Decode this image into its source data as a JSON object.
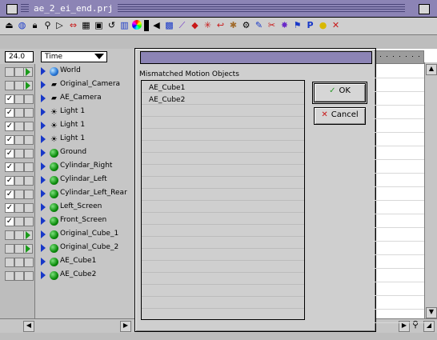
{
  "window": {
    "title": "ae_2_ei_end.prj"
  },
  "toolbar": {
    "icons": [
      "eject-icon",
      "disc-icon",
      "lock-icon",
      "magnifier-icon",
      "play-icon",
      "fit-icon",
      "film-icon",
      "save-icon",
      "undo-icon",
      "strip-icon",
      "color-wheel-icon",
      "lightning-icon",
      "speaker-icon",
      "grid-icon",
      "wand-icon",
      "bone-icon",
      "cross-icon",
      "hook-icon",
      "figure-icon",
      "dish-icon",
      "gear-icon",
      "pencil-icon",
      "tool-icon",
      "network-icon",
      "flag-icon",
      "p-icon",
      "bulb-icon",
      "marker-icon"
    ],
    "p_label": "P"
  },
  "outline": {
    "fps": "24.0",
    "time_select": "Time",
    "items": [
      {
        "label": "World",
        "icon": "world",
        "check": false,
        "track": "play"
      },
      {
        "label": "Original_Camera",
        "icon": "camera",
        "check": false,
        "track": "play"
      },
      {
        "label": "AE_Camera",
        "icon": "camera",
        "check": true,
        "track": "none"
      },
      {
        "label": "Light 1",
        "icon": "light",
        "check": true,
        "track": "none"
      },
      {
        "label": "Light 1",
        "icon": "light",
        "check": true,
        "track": "none"
      },
      {
        "label": "Light 1",
        "icon": "light",
        "check": true,
        "track": "none"
      },
      {
        "label": "Ground",
        "icon": "object",
        "check": true,
        "track": "none"
      },
      {
        "label": "Cylindar_Right",
        "icon": "object",
        "check": true,
        "track": "none"
      },
      {
        "label": "Cylindar_Left",
        "icon": "object",
        "check": true,
        "track": "none"
      },
      {
        "label": "Cylindar_Left_Rear",
        "icon": "object",
        "check": true,
        "track": "none"
      },
      {
        "label": "Left_Screen",
        "icon": "object",
        "check": true,
        "track": "none"
      },
      {
        "label": "Front_Screen",
        "icon": "object",
        "check": true,
        "track": "none"
      },
      {
        "label": "Original_Cube_1",
        "icon": "object",
        "check": false,
        "track": "play"
      },
      {
        "label": "Original_Cube_2",
        "icon": "object",
        "check": false,
        "track": "play"
      },
      {
        "label": "AE_Cube1",
        "icon": "object",
        "check": false,
        "track": "none"
      },
      {
        "label": "AE_Cube2",
        "icon": "object",
        "check": false,
        "track": "none"
      }
    ]
  },
  "dialog": {
    "heading": "Mismatched Motion Objects",
    "objects": [
      "AE_Cube1",
      "AE_Cube2"
    ],
    "ok_label": "OK",
    "cancel_label": "Cancel",
    "ok_icon": "check-icon",
    "cancel_icon": "x-icon"
  },
  "colors": {
    "titlebar": "#8c84b5",
    "accent_blue": "#1838c8",
    "object_green": "#0a8a0a",
    "ok_check": "#2a9a2a",
    "cancel_x": "#c81818"
  }
}
